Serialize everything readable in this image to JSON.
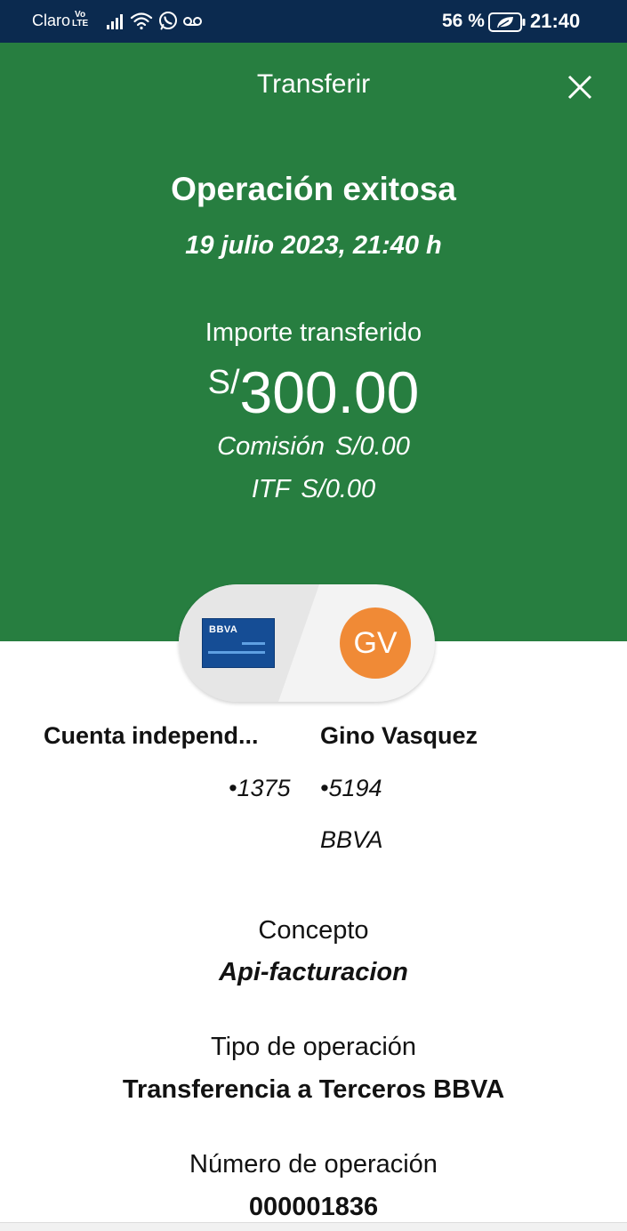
{
  "status_bar": {
    "carrier": "Claro",
    "volte_top": "Vo",
    "volte_bottom": "LTE",
    "battery": "56 %",
    "time": "21:40"
  },
  "header": {
    "title": "Transferir",
    "close_icon": "close-icon"
  },
  "result": {
    "title": "Operación exitosa",
    "date": "19 julio 2023, 21:40 h"
  },
  "amount": {
    "label": "Importe transferido",
    "currency": "S/",
    "value": "300.00",
    "commission_label": "Comisión",
    "commission_value": "S/0.00",
    "itf_label": "ITF",
    "itf_value": "S/0.00"
  },
  "transfer": {
    "card_logo": "BBVA",
    "avatar_initials": "GV",
    "colors": {
      "header": "#277e40",
      "card": "#154d95",
      "avatar": "#f08a36"
    }
  },
  "origin": {
    "name": "Cuenta independ...",
    "number": "•1375"
  },
  "destination": {
    "name": "Gino Vasquez",
    "number": "•5194",
    "bank": "BBVA"
  },
  "details": {
    "concept_label": "Concepto",
    "concept_value": "Api-facturacion",
    "type_label": "Tipo de operación",
    "type_value": "Transferencia a Terceros BBVA",
    "number_label": "Número de operación",
    "number_value": "000001836"
  }
}
